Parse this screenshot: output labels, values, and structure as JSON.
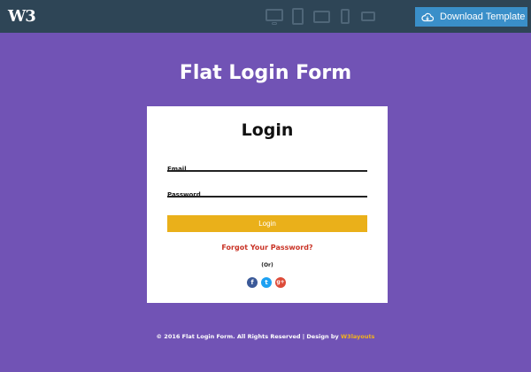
{
  "topbar": {
    "logo_text": "W3",
    "devices": [
      "desktop-icon",
      "tablet-portrait-icon",
      "tablet-landscape-icon",
      "phone-portrait-icon",
      "phone-landscape-icon"
    ],
    "download_label": "Download Template"
  },
  "page": {
    "title": "Flat Login Form"
  },
  "form": {
    "title": "Login",
    "email_placeholder": "Email",
    "password_placeholder": "Password",
    "submit_label": "Login",
    "forgot_label": "Forgot Your Password?",
    "or_label": "(Or)",
    "social": [
      {
        "name": "facebook-icon",
        "glyph": "f",
        "color": "#3b5998"
      },
      {
        "name": "twitter-icon",
        "glyph": "t",
        "color": "#1da1f2"
      },
      {
        "name": "google-plus-icon",
        "glyph": "g+",
        "color": "#dd4b39"
      }
    ]
  },
  "footer": {
    "text": "© 2016 Flat Login Form. All Rights Reserved | Design by ",
    "brand": "W3layouts"
  },
  "colors": {
    "background": "#7153b5",
    "topbar": "#2e4556",
    "download_button": "#3a8fc9",
    "login_button": "#eab01a",
    "forgot_link": "#c93326",
    "footer_brand": "#f3b21c"
  }
}
